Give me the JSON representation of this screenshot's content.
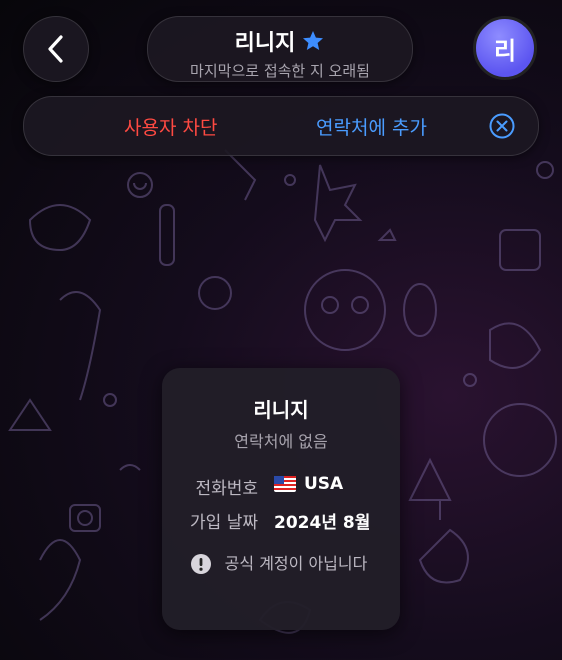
{
  "header": {
    "back_icon": "chevron-left-icon",
    "title": "리니지",
    "title_badge_icon": "star-badge-icon",
    "status": "마지막으로 접속한 지 오래됨",
    "avatar_letter": "리",
    "avatar_color": "#6a64f5"
  },
  "action_bar": {
    "block_label": "사용자 차단",
    "add_contact_label": "연락처에 추가",
    "close_icon": "close-circle-icon",
    "block_color": "#ff4a42",
    "add_color": "#4a9cff"
  },
  "info_card": {
    "name": "리니지",
    "subtitle": "연락처에 없음",
    "phone_label": "전화번호",
    "phone_flag_icon": "us-flag-icon",
    "phone_value": "USA",
    "join_label": "가입 날짜",
    "join_value": "2024년 8월",
    "note_icon": "exclamation-circle-icon",
    "note_text": "공식 계정이 아닙니다"
  }
}
